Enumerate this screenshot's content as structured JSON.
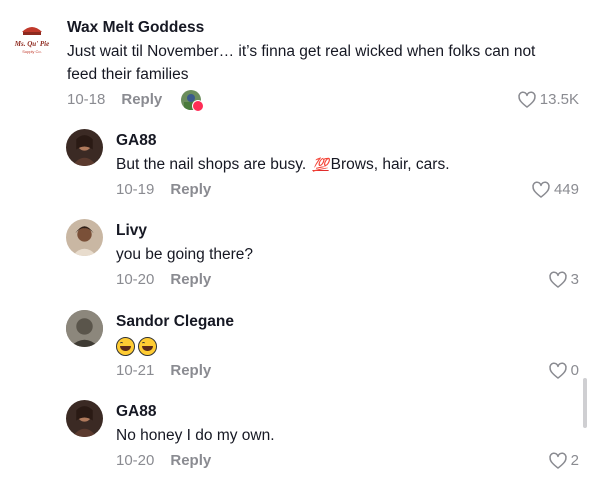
{
  "comments": [
    {
      "username": "Wax Melt Goddess",
      "text": "Just wait til November… it’s finna get real wicked when folks can not feed their families",
      "date": "10-18",
      "reply_label": "Reply",
      "likes": "13.5K",
      "avatar_text": "Ms. Qu' Pie",
      "avatar_subtext": "Supply Co."
    },
    {
      "username": "GA88",
      "text_before": "But the nail shops are busy.",
      "emoji": "💯",
      "text_after": "Brows, hair, cars.",
      "date": "10-19",
      "reply_label": "Reply",
      "likes": "449"
    },
    {
      "username": "Livy",
      "text": "you be going there?",
      "date": "10-20",
      "reply_label": "Reply",
      "likes": "3"
    },
    {
      "username": "Sandor Clegane",
      "emojis": [
        "😂",
        "😂"
      ],
      "date": "10-21",
      "reply_label": "Reply",
      "likes": "0"
    },
    {
      "username": "GA88",
      "text": "No honey I do my own.",
      "date": "10-20",
      "reply_label": "Reply",
      "likes": "2"
    }
  ],
  "icons": {
    "like": "heart-outline-icon",
    "creator_liked": "creator-liked-avatar"
  },
  "colors": {
    "meta": "#8a8b91",
    "text": "#161823",
    "accent": "#fe2c55"
  }
}
